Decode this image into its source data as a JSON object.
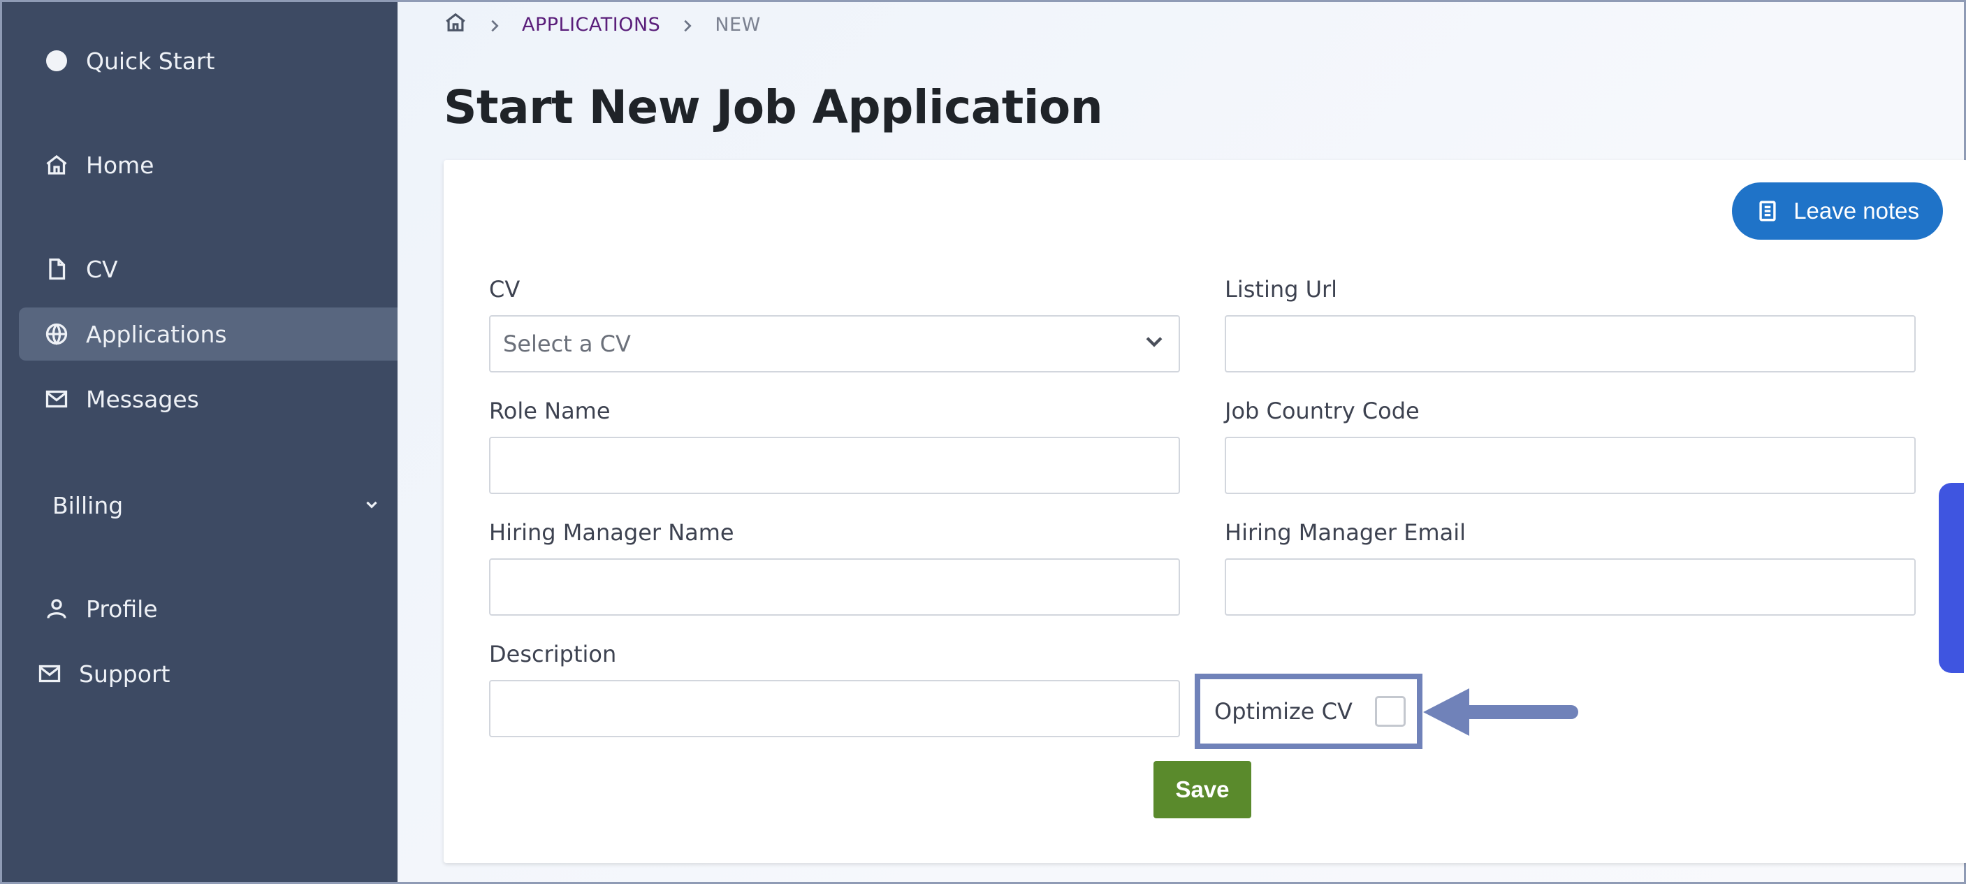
{
  "sidebar": {
    "items": [
      {
        "label": "Quick Start",
        "icon": "circle-dot-icon"
      },
      {
        "label": "Home",
        "icon": "home-icon"
      },
      {
        "label": "CV",
        "icon": "document-icon"
      },
      {
        "label": "Applications",
        "icon": "globe-icon",
        "active": true
      },
      {
        "label": "Messages",
        "icon": "mail-icon"
      },
      {
        "label": "Profile",
        "icon": "user-icon"
      },
      {
        "label": "Support",
        "icon": "mail-icon"
      }
    ],
    "billing_label": "Billing"
  },
  "breadcrumb": {
    "link": "APPLICATIONS",
    "current": "NEW"
  },
  "page_title": "Start New Job Application",
  "actions": {
    "leave_notes": "Leave notes",
    "save": "Save"
  },
  "form": {
    "cv_label": "CV",
    "cv_placeholder": "Select a CV",
    "listing_url_label": "Listing Url",
    "role_name_label": "Role Name",
    "job_country_code_label": "Job Country Code",
    "hiring_manager_name_label": "Hiring Manager Name",
    "hiring_manager_email_label": "Hiring Manager Email",
    "description_label": "Description",
    "optimize_cv_label": "Optimize CV"
  },
  "colors": {
    "sidebar_bg": "#3d4a63",
    "primary_button": "#1f73c8",
    "save_button": "#5a8a2c",
    "highlight": "#7082b9",
    "breadcrumb_link": "#5a1e7a"
  }
}
